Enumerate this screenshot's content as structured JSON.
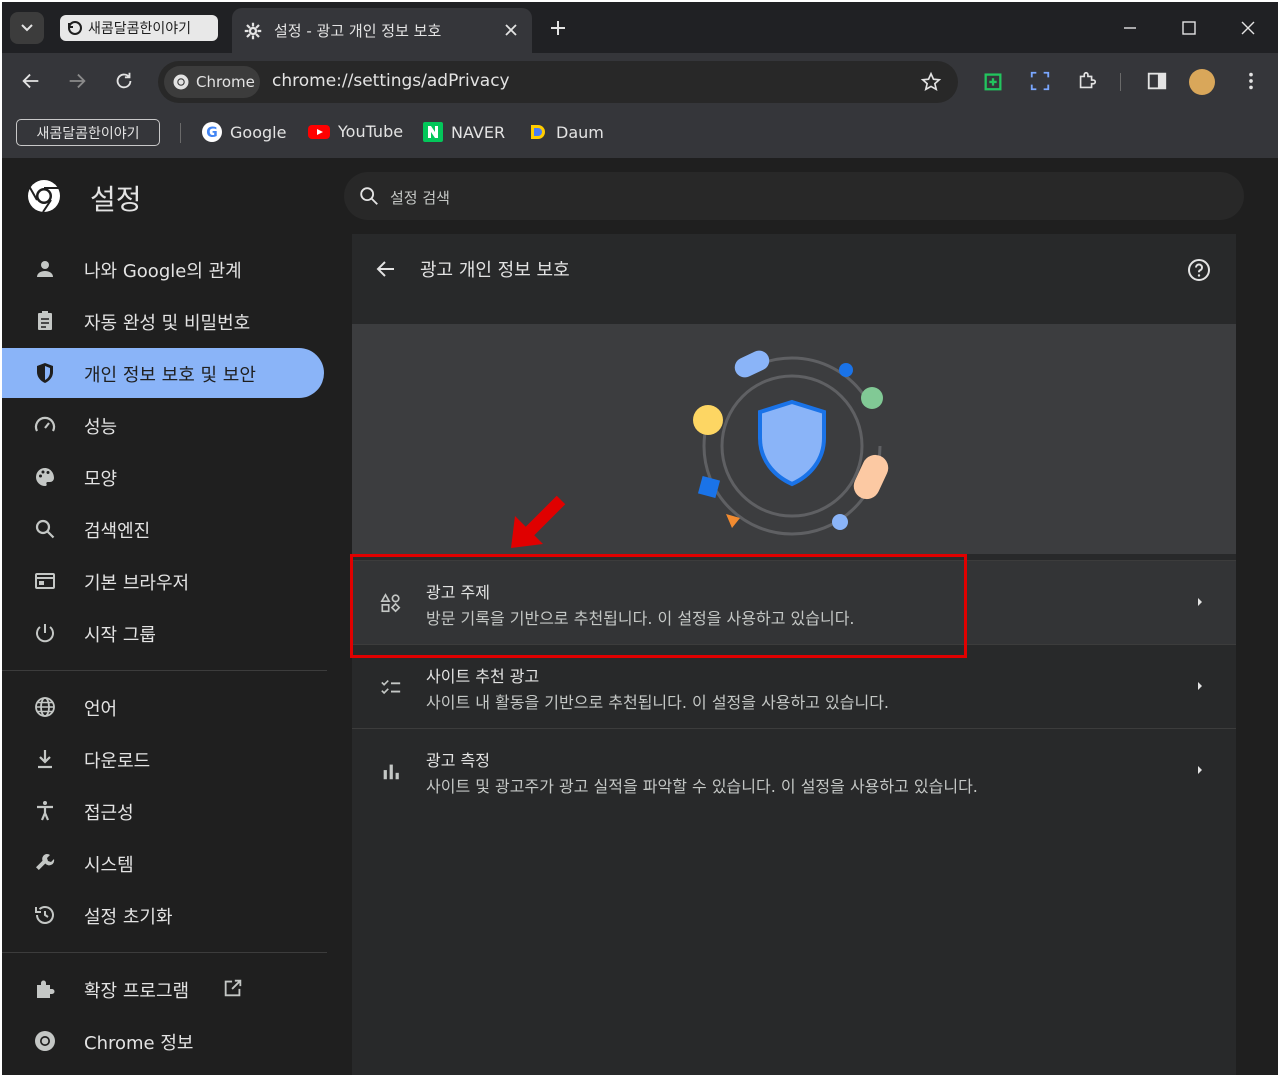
{
  "browser": {
    "tab_group_label": "새콤달콤한이야기",
    "active_tab_title": "설정 - 광고 개인 정보 보호",
    "omnibox_chip": "Chrome",
    "url": "chrome://settings/adPrivacy",
    "bookmark_group": "새콤달콤한이야기",
    "bookmarks": [
      {
        "label": "Google",
        "icon": "google-icon"
      },
      {
        "label": "YouTube",
        "icon": "youtube-icon"
      },
      {
        "label": "NAVER",
        "icon": "naver-icon"
      },
      {
        "label": "Daum",
        "icon": "daum-icon"
      }
    ]
  },
  "settings": {
    "title": "설정",
    "search_placeholder": "설정 검색"
  },
  "sidebar": {
    "items": [
      {
        "label": "나와 Google의 관계",
        "icon": "person-icon"
      },
      {
        "label": "자동 완성 및 비밀번호",
        "icon": "clipboard-icon"
      },
      {
        "label": "개인 정보 보호 및 보안",
        "icon": "shield-icon",
        "active": true
      },
      {
        "label": "성능",
        "icon": "speedometer-icon"
      },
      {
        "label": "모양",
        "icon": "palette-icon"
      },
      {
        "label": "검색엔진",
        "icon": "search-icon"
      },
      {
        "label": "기본 브라우저",
        "icon": "browser-icon"
      },
      {
        "label": "시작 그룹",
        "icon": "power-icon"
      },
      {
        "label": "언어",
        "icon": "globe-icon"
      },
      {
        "label": "다운로드",
        "icon": "download-icon"
      },
      {
        "label": "접근성",
        "icon": "accessibility-icon"
      },
      {
        "label": "시스템",
        "icon": "wrench-icon"
      },
      {
        "label": "설정 초기화",
        "icon": "history-icon"
      },
      {
        "label": "확장 프로그램",
        "icon": "puzzle-icon"
      },
      {
        "label": "Chrome 정보",
        "icon": "chrome-icon"
      }
    ]
  },
  "main": {
    "page_title": "광고 개인 정보 보호",
    "rows": [
      {
        "title": "광고 주제",
        "subtitle": "방문 기록을 기반으로 추천됩니다. 이 설정을 사용하고 있습니다.",
        "icon": "ad-topics-icon"
      },
      {
        "title": "사이트 추천 광고",
        "subtitle": "사이트 내 활동을 기반으로 추천됩니다. 이 설정을 사용하고 있습니다.",
        "icon": "checklist-icon"
      },
      {
        "title": "광고 측정",
        "subtitle": "사이트 및 광고주가 광고 실적을 파악할 수 있습니다. 이 설정을 사용하고 있습니다.",
        "icon": "bar-chart-icon"
      }
    ]
  },
  "colors": {
    "accent": "#8ab4f8",
    "annotation": "#e00000"
  }
}
